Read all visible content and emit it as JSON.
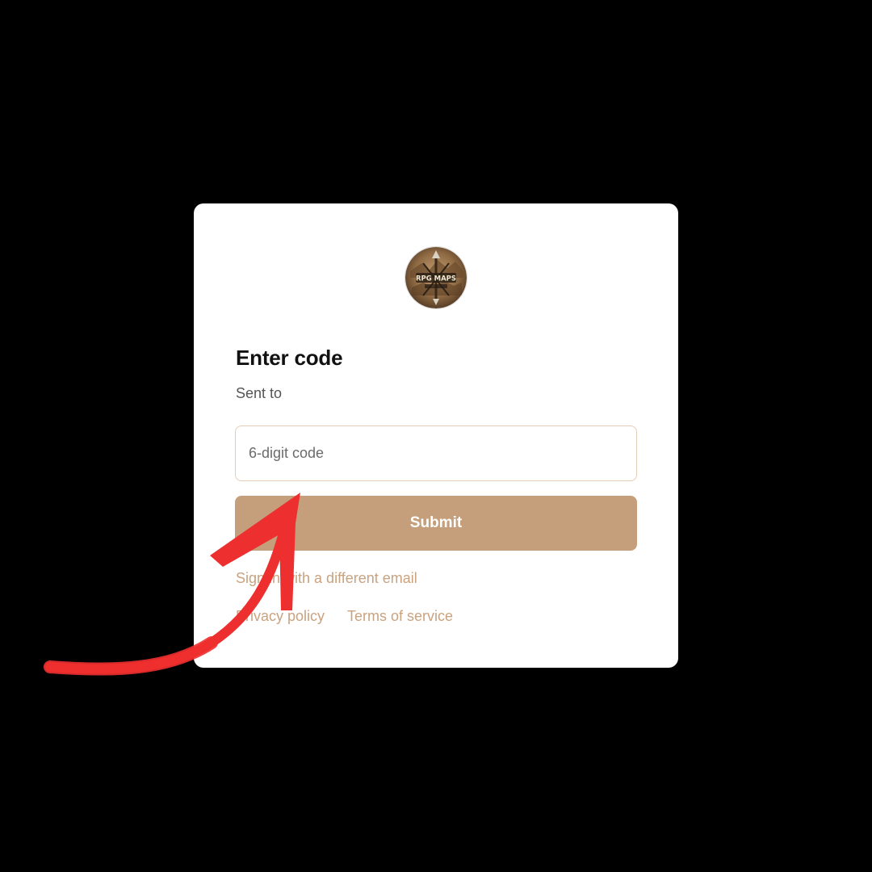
{
  "logo": {
    "text_top": "RPG MAPS",
    "icon": "rpg-maps-logo"
  },
  "form": {
    "title": "Enter code",
    "sent_to_label": "Sent to",
    "code_placeholder": "6-digit code",
    "code_value": "",
    "submit_label": "Submit"
  },
  "links": {
    "different_email": "Sign in with a different email",
    "privacy": "Privacy policy",
    "terms": "Terms of service"
  },
  "colors": {
    "background": "#000000",
    "card": "#ffffff",
    "accent": "#c59f7b",
    "link": "#c9a27f",
    "annotation_arrow": "#ee2f2f"
  }
}
